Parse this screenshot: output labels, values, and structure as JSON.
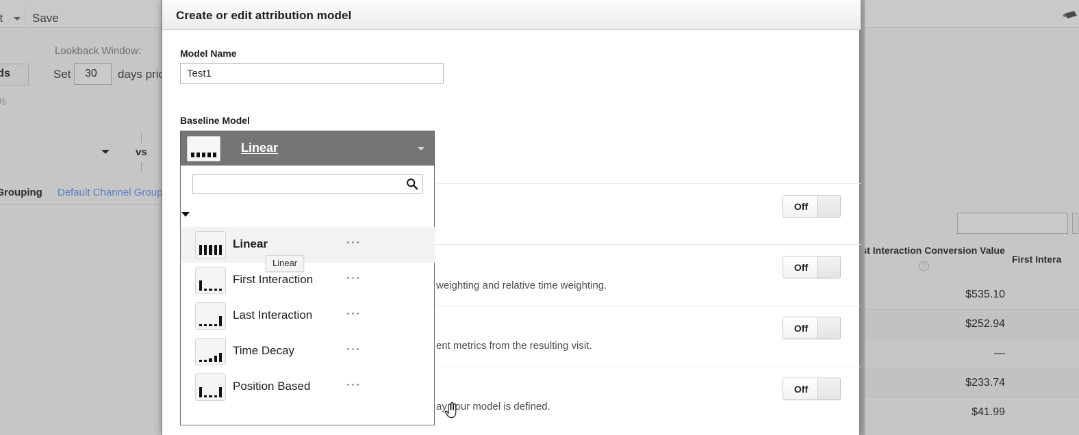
{
  "background": {
    "toolbar": {
      "export_label": "ort",
      "export_caret_icon": "chevron-down-icon",
      "save_label": "Save"
    },
    "lookback": {
      "label": "Lookback Window:",
      "set_label": "Set",
      "days_value": "30",
      "days_suffix": "days prior t"
    },
    "ads_chip_label": "e Ads",
    "percent_label": "%",
    "compare_label": "vs",
    "grouping_left_label": "l Grouping",
    "grouping_link_label": "Default Channel Grouping",
    "table": {
      "column_1": "rst Interaction Conversion Value",
      "column_1_help_icon": "help-circle-icon",
      "column_2": "First Intera",
      "values": [
        "$535.10",
        "$252.94",
        "—",
        "$233.74",
        "$41.99"
      ]
    },
    "corner_icon": "share-icon"
  },
  "modal": {
    "title": "Create or edit attribution model",
    "model_name": {
      "label": "Model Name",
      "value": "Test1",
      "placeholder": ""
    },
    "baseline_model": {
      "label": "Baseline Model",
      "selected": "Linear",
      "caret_icon": "chevron-down-icon",
      "icon_name": "linear-model-icon"
    },
    "dropdown": {
      "search_value": "",
      "search_placeholder": "",
      "search_icon": "search-icon",
      "collapse_icon": "triangle-down-icon",
      "menu_icon": "ellipsis-icon",
      "items": [
        {
          "label": "Linear",
          "icon": "linear-model-icon",
          "menu": "···",
          "selected": true,
          "bars": [
            1,
            1,
            1,
            1,
            1
          ]
        },
        {
          "label": "First Interaction",
          "icon": "first-interaction-model-icon",
          "menu": "···",
          "selected": false,
          "bars": [
            1,
            0.18,
            0.18,
            0.18,
            0.18
          ]
        },
        {
          "label": "Last Interaction",
          "icon": "last-interaction-model-icon",
          "menu": "···",
          "selected": false,
          "bars": [
            0.18,
            0.18,
            0.18,
            0.18,
            1
          ]
        },
        {
          "label": "Time Decay",
          "icon": "time-decay-model-icon",
          "menu": "···",
          "selected": false,
          "bars": [
            0.1,
            0.14,
            0.32,
            0.6,
            0.85
          ]
        },
        {
          "label": "Position Based",
          "icon": "position-based-model-icon",
          "menu": "···",
          "selected": false,
          "bars": [
            1,
            0.18,
            0.18,
            0.18,
            1
          ]
        }
      ],
      "hover_tooltip": "Linear",
      "cursor_icon": "pointing-hand-cursor"
    },
    "settings_rows": [
      {
        "description": "",
        "toggle_label": "Off"
      },
      {
        "description": "weighting and relative time weighting.",
        "toggle_label": "Off"
      },
      {
        "description": "ent metrics from the resulting visit.",
        "toggle_label": "Off"
      },
      {
        "description": "ay your model is defined.",
        "toggle_label": "Off"
      }
    ]
  },
  "colors": {
    "modal_bg": "#ffffff",
    "backdrop": "#c6c6c6",
    "select_header": "#757575",
    "link": "#5b7fc4"
  }
}
